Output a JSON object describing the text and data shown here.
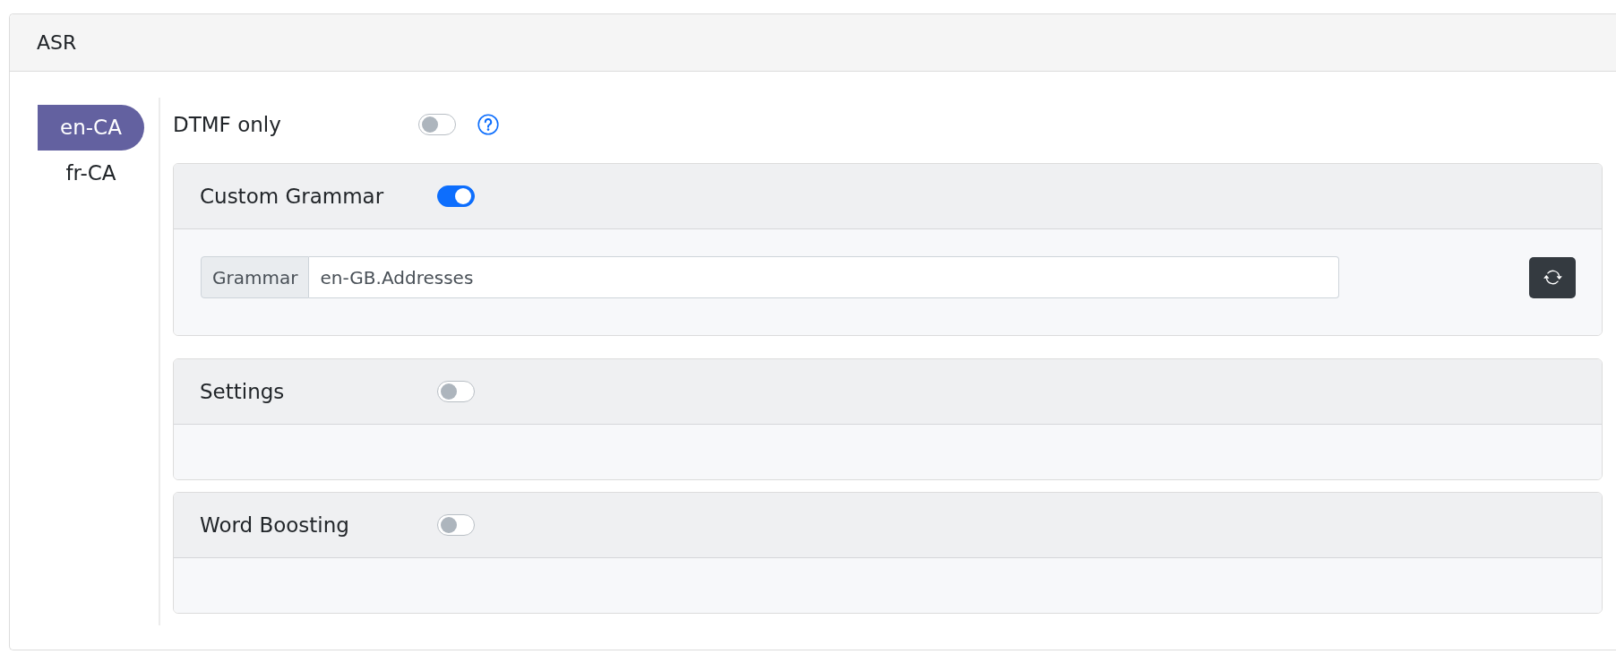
{
  "card": {
    "title": "ASR"
  },
  "languages": [
    {
      "label": "en-CA",
      "selected": true
    },
    {
      "label": "fr-CA",
      "selected": false
    }
  ],
  "dtmf_only": {
    "label": "DTMF only",
    "on": false
  },
  "sections": [
    {
      "title": "Custom Grammar",
      "on": true,
      "field": {
        "label": "Grammar",
        "value": "en-GB.Addresses"
      }
    },
    {
      "title": "Settings",
      "on": false
    },
    {
      "title": "Word Boosting",
      "on": false
    }
  ]
}
